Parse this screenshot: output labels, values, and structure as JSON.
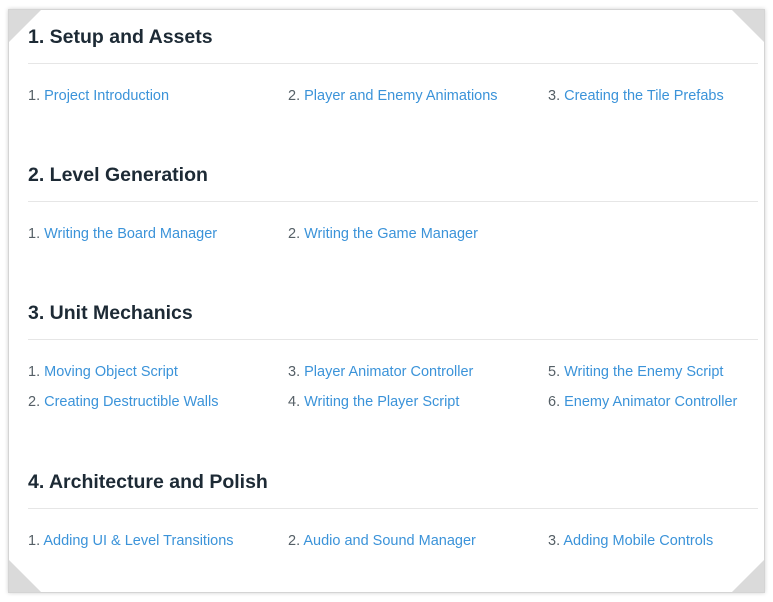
{
  "sections": [
    {
      "title": "1. Setup and Assets",
      "items": [
        {
          "num": "1.",
          "label": "Project Introduction"
        },
        {
          "num": "2.",
          "label": "Player and Enemy Animations"
        },
        {
          "num": "3.",
          "label": "Creating the Tile Prefabs"
        }
      ]
    },
    {
      "title": "2. Level Generation",
      "items": [
        {
          "num": "1.",
          "label": "Writing the Board Manager"
        },
        {
          "num": "2.",
          "label": "Writing the Game Manager"
        }
      ]
    },
    {
      "title": "3. Unit Mechanics",
      "items": [
        {
          "num": "1.",
          "label": "Moving Object Script"
        },
        {
          "num": "2.",
          "label": "Creating Destructible Walls"
        },
        {
          "num": "3.",
          "label": "Player Animator Controller"
        },
        {
          "num": "4.",
          "label": "Writing the Player Script"
        },
        {
          "num": "5.",
          "label": "Writing the Enemy Script"
        },
        {
          "num": "6.",
          "label": "Enemy Animator Controller"
        }
      ]
    },
    {
      "title": "4. Architecture and Polish",
      "items": [
        {
          "num": "1.",
          "label": "Adding UI & Level Transitions"
        },
        {
          "num": "2.",
          "label": "Audio and Sound Manager"
        },
        {
          "num": "3.",
          "label": "Adding Mobile Controls"
        }
      ]
    }
  ],
  "colors": {
    "heading": "#1d2a35",
    "link": "#3b93d9",
    "number": "#555f66",
    "divider": "#e6e6e6"
  }
}
